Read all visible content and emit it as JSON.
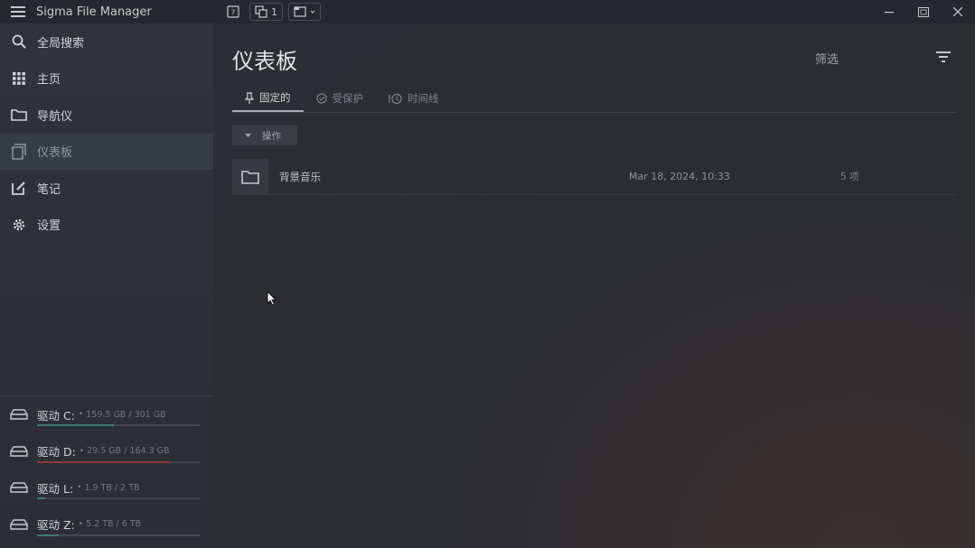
{
  "titlebar": {
    "app_title": "Sigma File Manager",
    "window_count": "1"
  },
  "sidebar": {
    "items": [
      {
        "label": "全局搜索",
        "icon": "search-icon"
      },
      {
        "label": "主页",
        "icon": "apps-grid-icon"
      },
      {
        "label": "导航仪",
        "icon": "folder-icon"
      },
      {
        "label": "仪表板",
        "icon": "dashboard-icon",
        "active": true
      },
      {
        "label": "笔记",
        "icon": "note-edit-icon"
      },
      {
        "label": "设置",
        "icon": "gear-icon"
      }
    ],
    "drives": [
      {
        "name": "驱动 C:",
        "sep": "•",
        "capacity": "159.5 GB / 301 GB",
        "used_fraction": 0.47,
        "warn": false
      },
      {
        "name": "驱动 D:",
        "sep": "•",
        "capacity": "29.5 GB / 164.3 GB",
        "used_fraction": 0.82,
        "warn": true
      },
      {
        "name": "驱动 L:",
        "sep": "•",
        "capacity": "1.9 TB / 2 TB",
        "used_fraction": 0.05,
        "warn": false
      },
      {
        "name": "驱动 Z:",
        "sep": "•",
        "capacity": "5.2 TB / 6 TB",
        "used_fraction": 0.13,
        "warn": false
      }
    ]
  },
  "main": {
    "title": "仪表板",
    "filter_label": "筛选",
    "tabs": [
      {
        "label": "固定的",
        "icon": "pin-icon"
      },
      {
        "label": "受保护",
        "icon": "shield-check-icon"
      },
      {
        "label": "时间线",
        "icon": "history-icon"
      }
    ],
    "actions_label": "操作",
    "items": [
      {
        "name": "背景音乐",
        "date": "Mar 18, 2024, 10:33",
        "count": "5 项"
      }
    ]
  },
  "colors": {
    "accent_drive": "#3d7a70",
    "warn_drive": "#8a3b3f",
    "background": "#2a2d31"
  }
}
